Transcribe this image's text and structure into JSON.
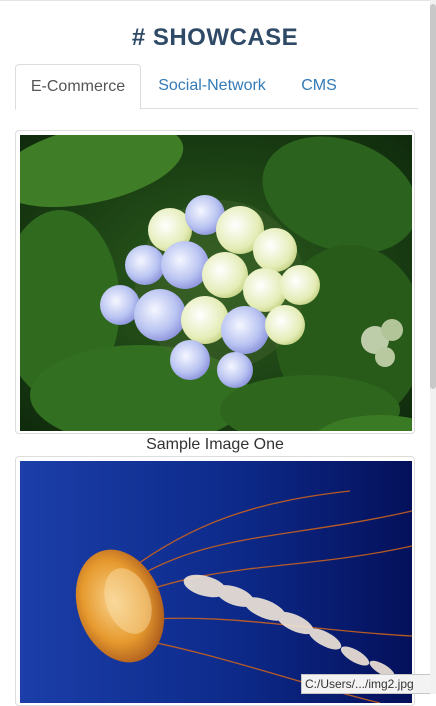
{
  "page": {
    "title": "# SHOWCASE"
  },
  "tabs": [
    {
      "label": "E-Commerce",
      "active": true
    },
    {
      "label": "Social-Network",
      "active": false
    },
    {
      "label": "CMS",
      "active": false
    }
  ],
  "gallery": [
    {
      "caption": "Sample Image One",
      "subject": "hydrangea-flower"
    },
    {
      "caption": "",
      "subject": "jellyfish"
    }
  ],
  "status_bar": {
    "link_preview": "C:/Users/.../img2.jpg"
  },
  "colors": {
    "title": "#2e4a66",
    "link": "#337ab7",
    "border": "#dddddd"
  }
}
